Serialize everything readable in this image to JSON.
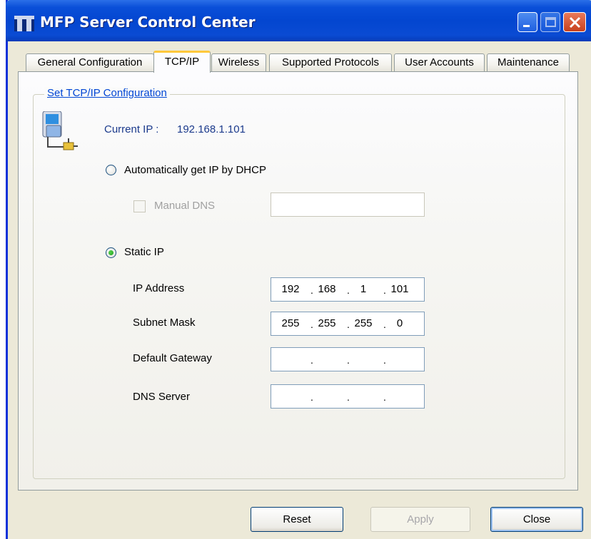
{
  "window": {
    "title": "MFP Server Control Center"
  },
  "tabs": [
    {
      "label": "General Configuration",
      "active": false
    },
    {
      "label": "TCP/IP",
      "active": true
    },
    {
      "label": "Wireless",
      "active": false
    },
    {
      "label": "Supported Protocols",
      "active": false
    },
    {
      "label": "User Accounts",
      "active": false
    },
    {
      "label": "Maintenance",
      "active": false
    }
  ],
  "tcpip": {
    "group_label": "Set TCP/IP Configuration",
    "current_ip_label": "Current IP :",
    "current_ip_value": "192.168.1.101",
    "dhcp_label": "Automatically get IP by DHCP",
    "dhcp_selected": false,
    "manual_dns_label": "Manual DNS",
    "manual_dns_value": "",
    "static_label": "Static IP",
    "static_selected": true,
    "ip_address": {
      "label": "IP Address",
      "octets": [
        "192",
        "168",
        "1",
        "101"
      ]
    },
    "subnet_mask": {
      "label": "Subnet Mask",
      "octets": [
        "255",
        "255",
        "255",
        "0"
      ]
    },
    "default_gateway": {
      "label": "Default Gateway",
      "octets": [
        "",
        "",
        "",
        ""
      ]
    },
    "dns_server": {
      "label": "DNS Server",
      "octets": [
        "",
        "",
        "",
        ""
      ]
    }
  },
  "buttons": {
    "reset": "Reset",
    "apply": "Apply",
    "close": "Close"
  },
  "colors": {
    "titlebar": "#0346d0",
    "face": "#ece9d8",
    "link_blue": "#0046d5",
    "active_tab_accent": "#ffc83c"
  }
}
